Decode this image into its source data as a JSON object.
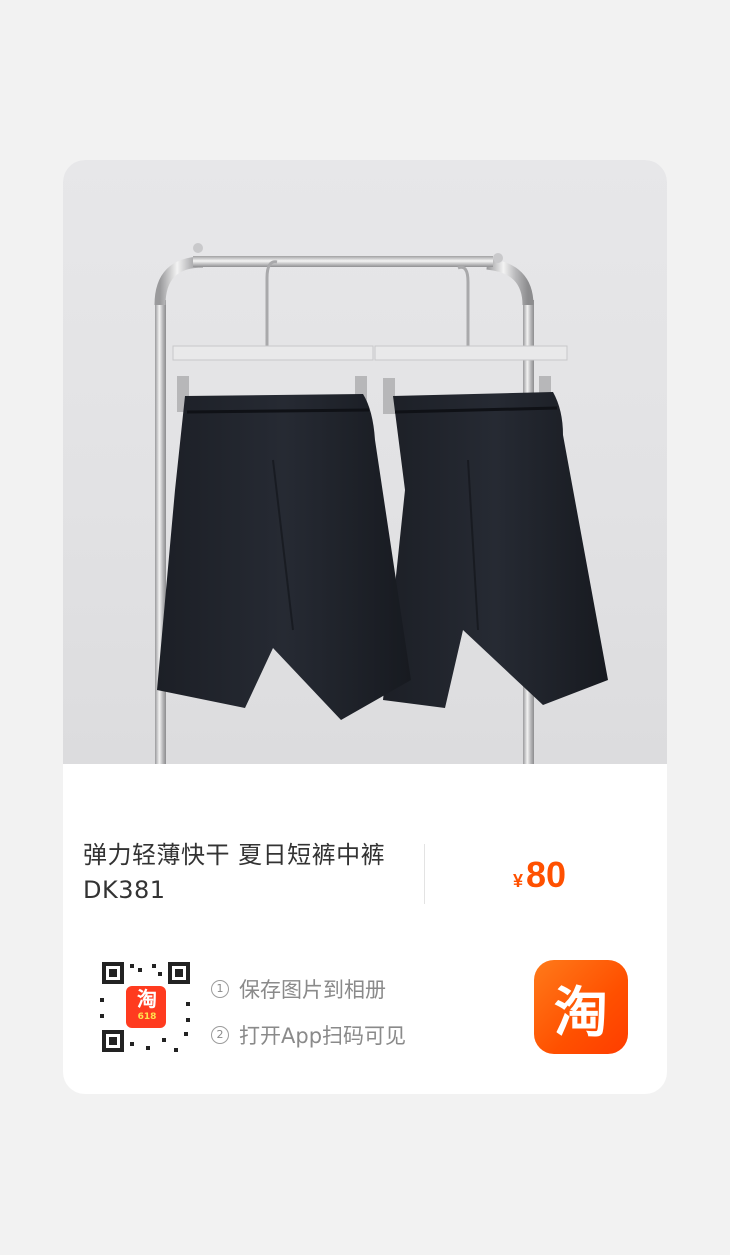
{
  "product": {
    "title": "弹力轻薄快干 夏日短裤中裤 DK381",
    "currency": "¥",
    "price": "80"
  },
  "share": {
    "steps": [
      {
        "num": "1",
        "text": "保存图片到相册"
      },
      {
        "num": "2",
        "text": "打开App扫码可见"
      }
    ],
    "qr_badge": "淘",
    "qr_badge_sub": "618",
    "app_icon": "淘"
  },
  "colors": {
    "accent": "#ff5000",
    "text": "#333333",
    "muted": "#8a8a8a"
  },
  "icons": [
    "product-photo",
    "qr-code",
    "taobao-app-icon"
  ]
}
